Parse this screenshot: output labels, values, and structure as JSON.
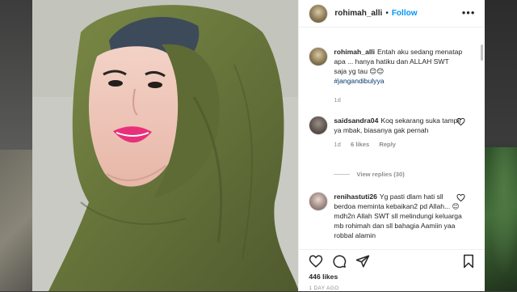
{
  "post": {
    "username": "rohimah_alli",
    "follow_label": "Follow",
    "caption": {
      "username": "rohimah_alli",
      "text": "Entah aku sedang menatap apa ... hanya hatiku dan ALLAH SWT saja yg tau 😊😊",
      "hashtag": "#jangandibulyya",
      "time": "1d"
    },
    "likes": "446 likes",
    "time_ago": "1 DAY AGO"
  },
  "comments": [
    {
      "username": "saidsandra04",
      "text": "Koq sekarang suka tampil ya mbak, biasanya gak pernah",
      "time": "1d",
      "likes": "6 likes",
      "reply_label": "Reply",
      "view_replies": "View replies (30)"
    },
    {
      "username": "renihastuti26",
      "text": "Yg pasti dlam hati sll berdoa meminta kebaikan2 pd Allah... 😊mdh2n Allah SWT sll melindungi keluarga mb rohimah dan sll bahagia Aamiin yaa robbal alamin"
    }
  ],
  "icons": {
    "like": "heart-icon",
    "comment": "comment-icon",
    "share": "share-icon",
    "save": "bookmark-icon",
    "more": "more-options-icon"
  },
  "colors": {
    "link": "#0095f6",
    "hashtag": "#00376b",
    "muted": "#8e8e8e",
    "text": "#262626",
    "hijab": "#66723a"
  }
}
